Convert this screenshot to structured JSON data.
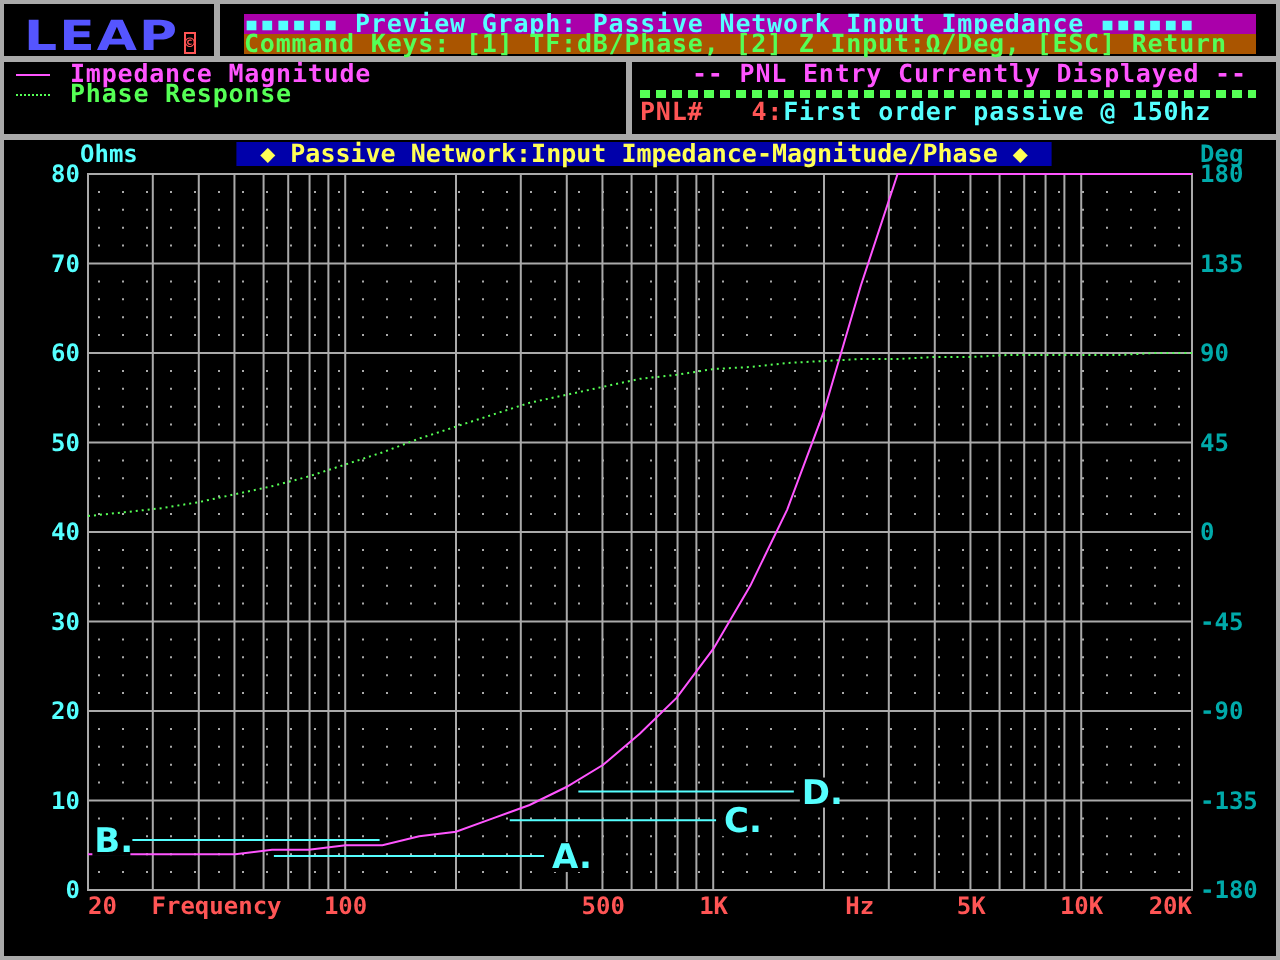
{
  "logo": {
    "text": "LEAP",
    "mark": "©"
  },
  "header": {
    "title": "▪▪▪▪▪▪ Preview Graph: Passive Network Input Impedance ▪▪▪▪▪▪",
    "command_keys": "Command Keys: [1] TF:dB/Phase, [2] Z Input:Ω/Deg, [ESC] Return"
  },
  "pnl_panel": {
    "heading": "-- PNL Entry Currently Displayed --",
    "label": "PNL#",
    "number": "4:",
    "description": "First order passive @ 150hz"
  },
  "chart": {
    "frequency_unit": "Hz",
    "chart_data": {
      "type": "line",
      "title": "◆ Passive Network:Input Impedance-Magnitude/Phase ◆",
      "xlabel": "Frequency",
      "ylabel": "Ohms",
      "y2label": "Deg",
      "grid": true,
      "ylim": [
        0,
        80
      ],
      "y2lim": [
        -180,
        180
      ],
      "categories": [
        "20",
        null,
        null,
        null,
        null,
        null,
        null,
        "100",
        null,
        null,
        null,
        null,
        null,
        null,
        "500",
        null,
        null,
        "1K",
        null,
        null,
        null,
        null,
        null,
        null,
        "5K",
        null,
        null,
        "10K",
        null,
        null,
        "20K"
      ],
      "series": [
        {
          "name": "Impedance Magnitude",
          "color": "#ff55ff",
          "line_style": "solid",
          "values": [
            4,
            4,
            4,
            4,
            4,
            4.5,
            4.5,
            5,
            5,
            6,
            6.5,
            8,
            9.5,
            11.5,
            14,
            17.5,
            21.5,
            27,
            34,
            42.5,
            53.5,
            67.5,
            80,
            80,
            80,
            80,
            80,
            80,
            80,
            80,
            80
          ]
        },
        {
          "name": "Phase Response",
          "color": "#55ff55",
          "line_style": "dotted",
          "axis": "y2",
          "values": [
            8,
            10,
            12,
            15,
            19,
            23,
            28,
            34,
            40,
            47,
            53,
            59,
            65,
            69,
            73,
            77,
            79,
            82,
            83,
            85,
            86,
            87,
            87,
            88,
            88,
            89,
            89,
            89,
            89,
            90,
            90
          ]
        }
      ],
      "yticks": [
        0,
        10,
        20,
        30,
        40,
        50,
        60,
        70,
        80
      ],
      "y2ticks": [
        -180,
        -135,
        -90,
        -45,
        0,
        45,
        90,
        135,
        180
      ],
      "annotations": [
        "A.",
        "B.",
        "C.",
        "D."
      ]
    }
  }
}
